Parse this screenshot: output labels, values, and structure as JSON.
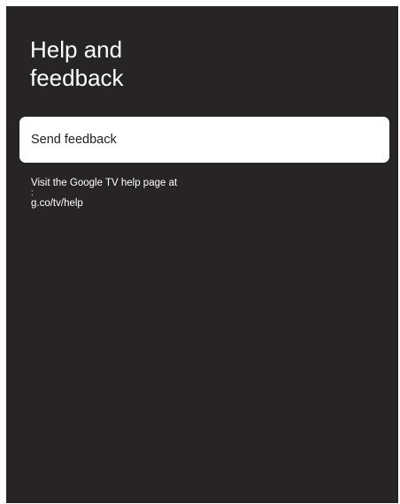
{
  "page": {
    "title_line1": "Help and",
    "title_line2": "feedback"
  },
  "items": {
    "send_feedback_label": "Send feedback"
  },
  "help": {
    "line1": "Visit the Google TV help page at",
    "colon": ":",
    "link": "g.co/tv/help"
  },
  "colors": {
    "background": "#262424",
    "card": "#ffffff",
    "text_light": "#ffffff",
    "text_dark": "#202124"
  }
}
